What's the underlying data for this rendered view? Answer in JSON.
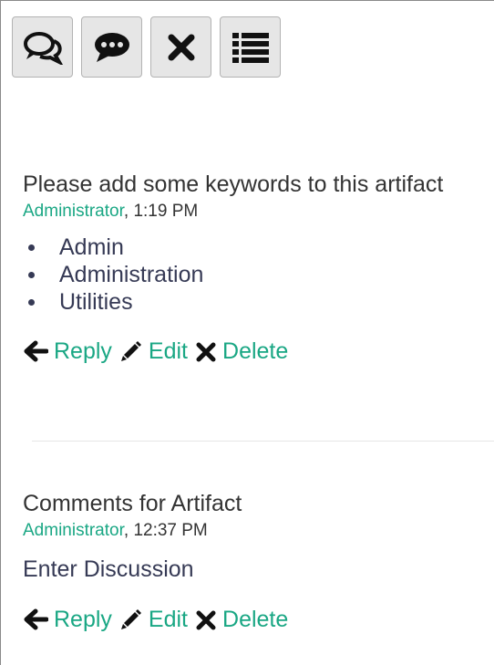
{
  "toolbar": {
    "buttons": [
      {
        "icon": "comments-outline-icon"
      },
      {
        "icon": "comment-dots-icon"
      },
      {
        "icon": "close-icon"
      },
      {
        "icon": "list-icon"
      }
    ]
  },
  "comments": [
    {
      "title": "Please add some keywords to this artifact",
      "author": "Administrator",
      "time_sep": ",",
      "time": "1:19 PM",
      "keywords": [
        "Admin",
        "Administration",
        "Utilities"
      ],
      "actions": {
        "reply": "Reply",
        "edit": "Edit",
        "delete": "Delete"
      }
    },
    {
      "title": "Comments for Artifact",
      "author": "Administrator",
      "time_sep": ",",
      "time": "12:37 PM",
      "body": "Enter Discussion",
      "actions": {
        "reply": "Reply",
        "edit": "Edit",
        "delete": "Delete"
      }
    }
  ],
  "colors": {
    "accent": "#1aa784",
    "text": "#333333",
    "list_text": "#363a55"
  }
}
